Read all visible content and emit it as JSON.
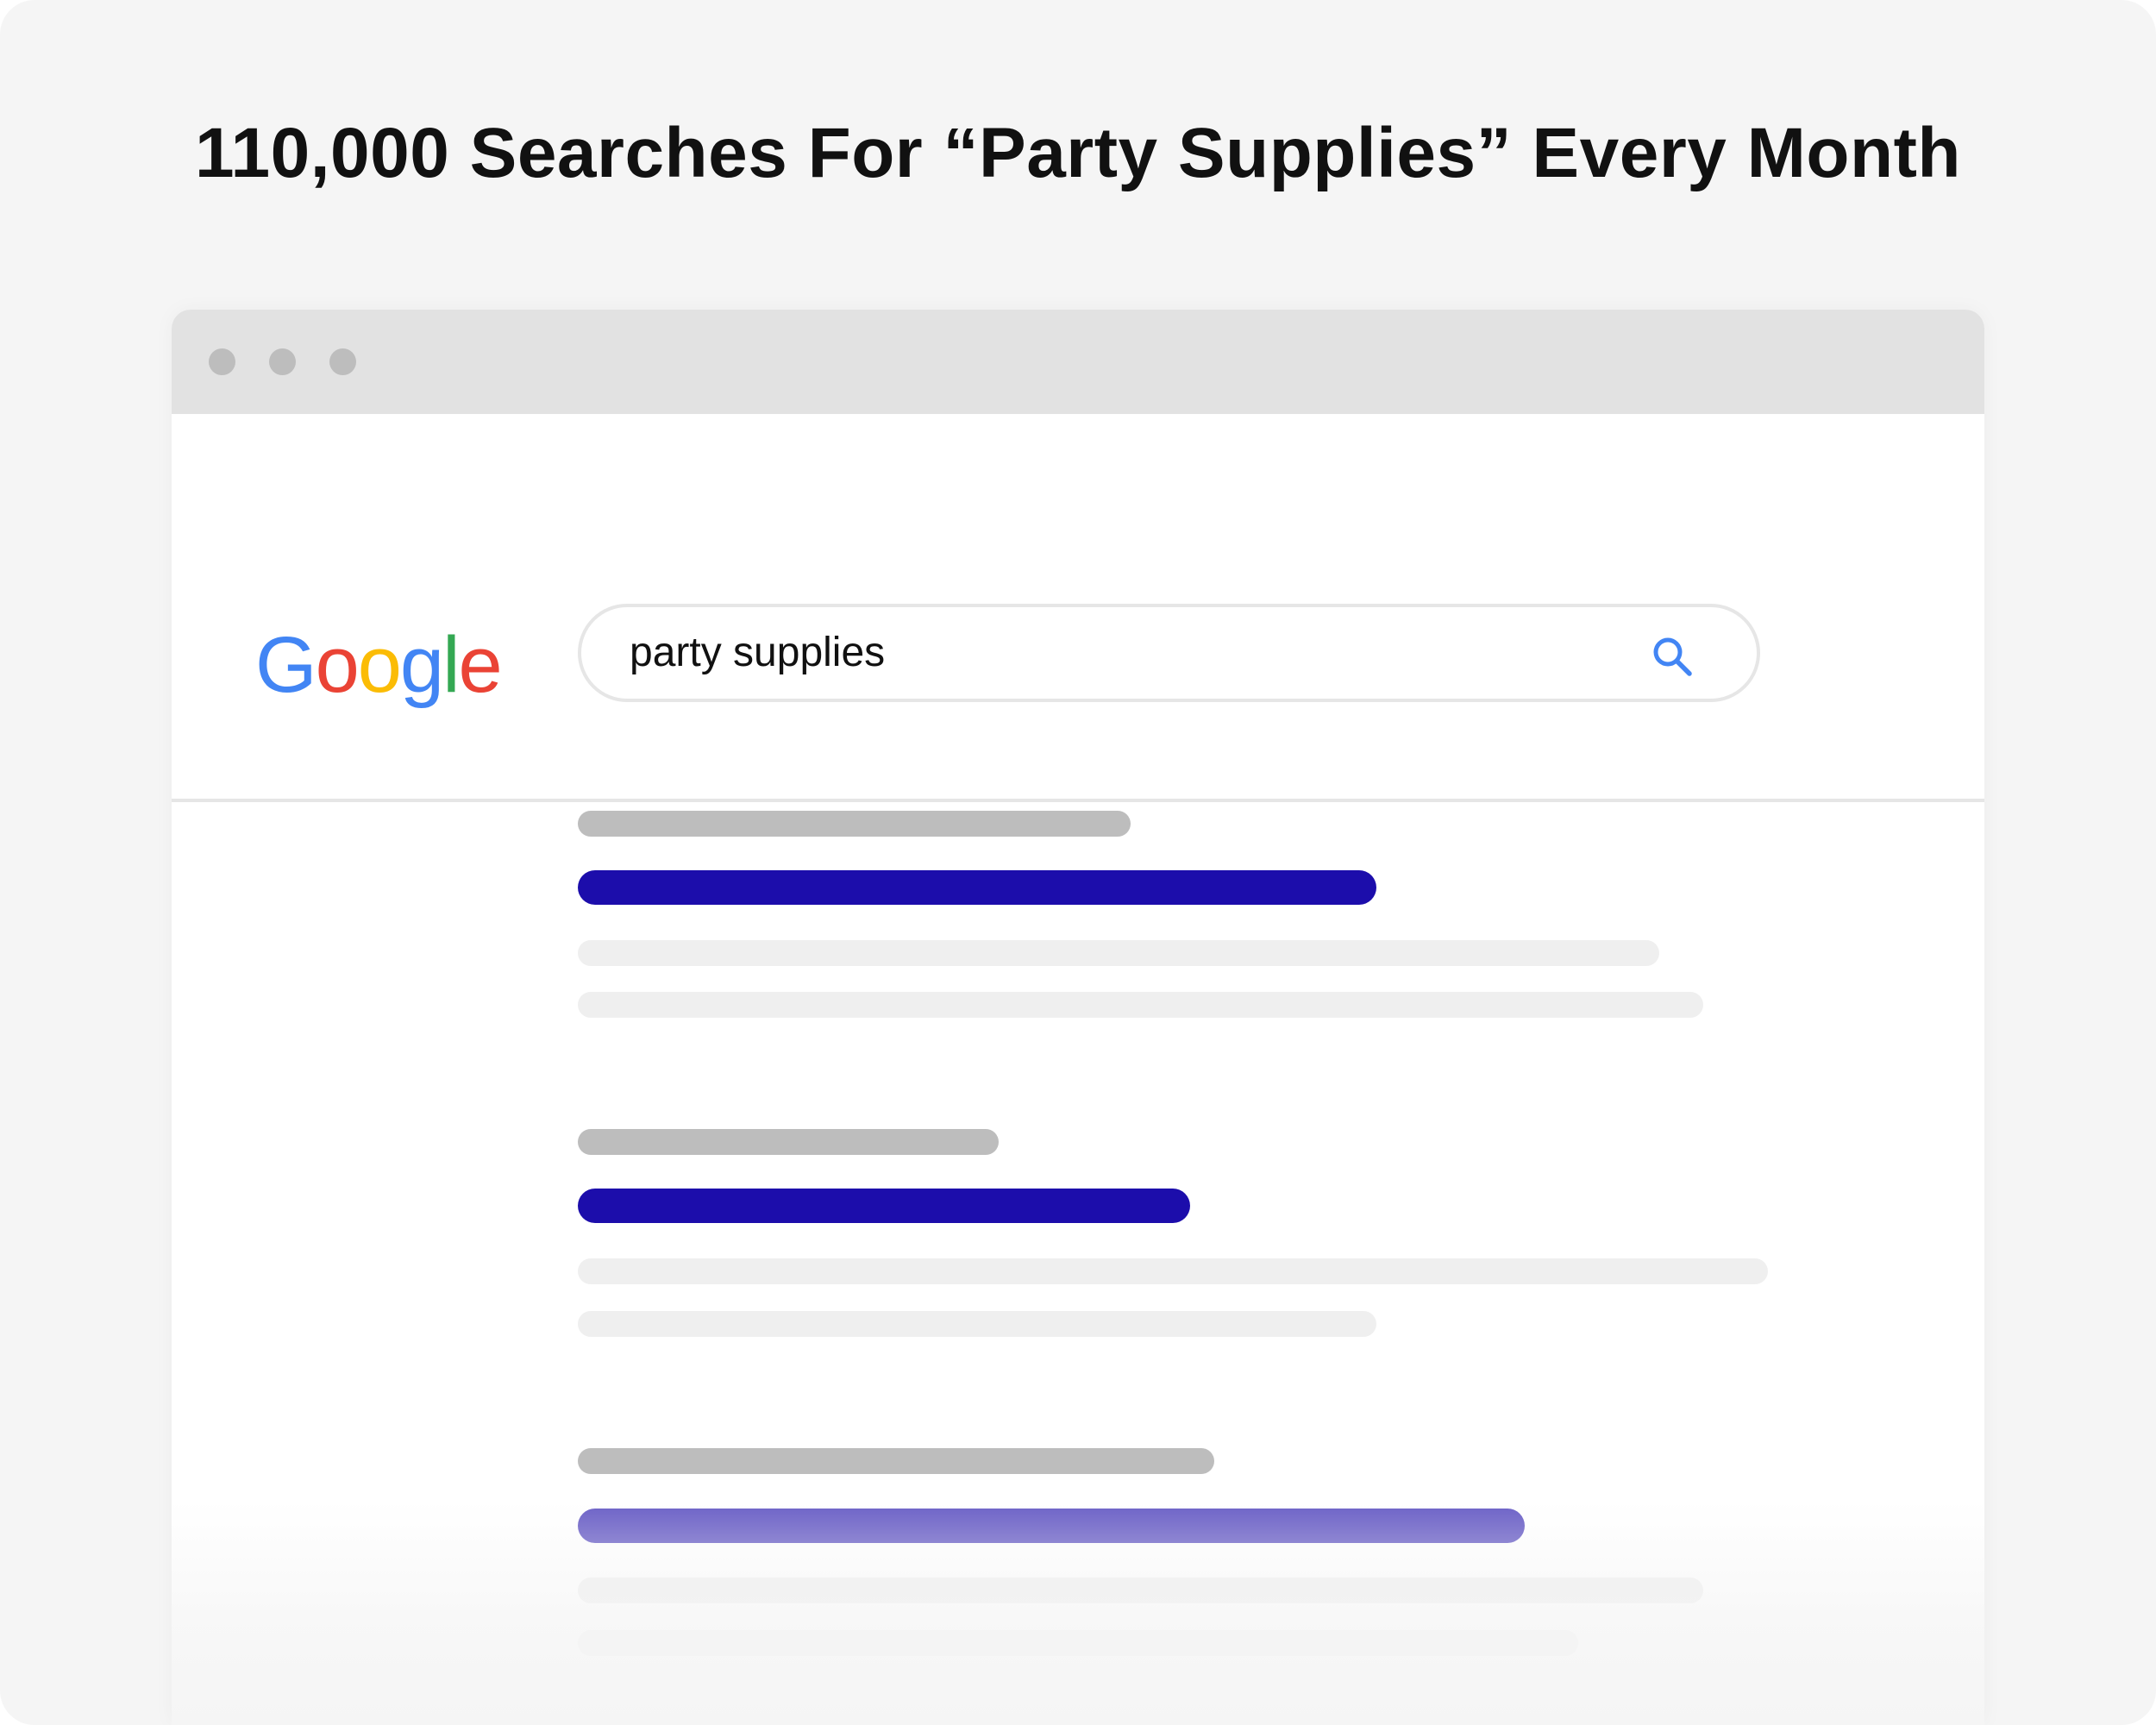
{
  "headline": "110,000 Searches For “Party Supplies” Every Month",
  "browser": {
    "window_dots": [
      "dot",
      "dot",
      "dot"
    ]
  },
  "search_engine": {
    "logo_letters": [
      {
        "char": "G",
        "color": "#4285F4"
      },
      {
        "char": "o",
        "color": "#EA4335"
      },
      {
        "char": "o",
        "color": "#FBBC05"
      },
      {
        "char": "g",
        "color": "#4285F4"
      },
      {
        "char": "l",
        "color": "#34A853"
      },
      {
        "char": "e",
        "color": "#EA4335"
      }
    ],
    "query": "party supplies",
    "search_icon": "search-icon",
    "search_icon_color": "#4285F4"
  },
  "colors": {
    "background": "#f5f5f5",
    "titlebar": "#e2e2e2",
    "result_link": "#1c0dab",
    "placeholder_url": "#bdbdbd",
    "placeholder_desc": "#efefef"
  }
}
